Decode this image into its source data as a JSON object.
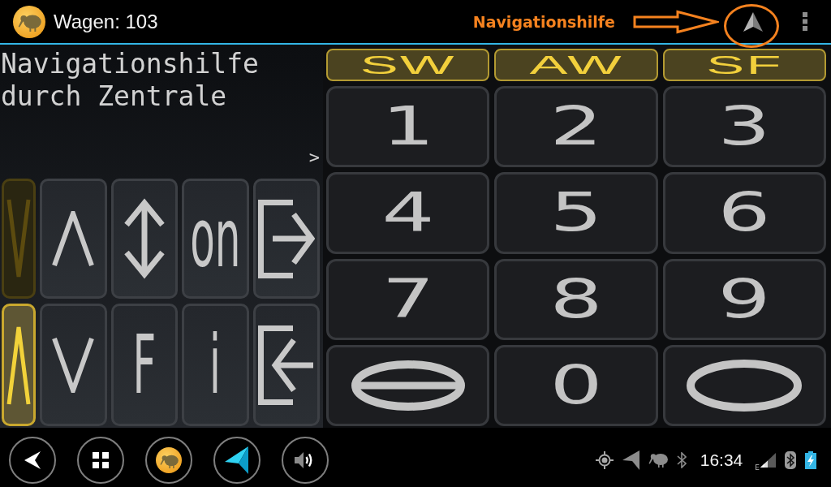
{
  "action_bar": {
    "title": "Wagen: 103",
    "annotation": "Navigationshilfe"
  },
  "message": {
    "text": "Navigationshilfe durch Zentrale",
    "prompt": ">"
  },
  "direction_toggle": [
    {
      "kind": "down",
      "selected": false
    },
    {
      "kind": "up",
      "selected": true
    }
  ],
  "control_keys": [
    {
      "kind": "up"
    },
    {
      "kind": "up_down"
    },
    {
      "kind": "text",
      "label": "on"
    },
    {
      "kind": "exit"
    },
    {
      "kind": "down"
    },
    {
      "kind": "text",
      "label": "F"
    },
    {
      "kind": "text",
      "label": "i"
    },
    {
      "kind": "enter"
    }
  ],
  "mode_keys": [
    "SW",
    "AW",
    "SF"
  ],
  "keypad": [
    {
      "kind": "digit",
      "label": "1"
    },
    {
      "kind": "digit",
      "label": "2"
    },
    {
      "kind": "digit",
      "label": "3"
    },
    {
      "kind": "digit",
      "label": "4"
    },
    {
      "kind": "digit",
      "label": "5"
    },
    {
      "kind": "digit",
      "label": "6"
    },
    {
      "kind": "digit",
      "label": "7"
    },
    {
      "kind": "digit",
      "label": "8"
    },
    {
      "kind": "digit",
      "label": "9"
    },
    {
      "kind": "bar_ring"
    },
    {
      "kind": "digit",
      "label": "0"
    },
    {
      "kind": "ring"
    }
  ],
  "nav_bar": {
    "buttons": [
      {
        "kind": "back"
      },
      {
        "kind": "apps"
      },
      {
        "kind": "app"
      },
      {
        "kind": "navigation"
      },
      {
        "kind": "volume"
      }
    ],
    "status": {
      "icons": [
        {
          "kind": "gps"
        },
        {
          "kind": "navigation"
        },
        {
          "kind": "bird"
        },
        {
          "kind": "bluetooth"
        }
      ],
      "time": "16:34",
      "network": "E"
    }
  }
}
